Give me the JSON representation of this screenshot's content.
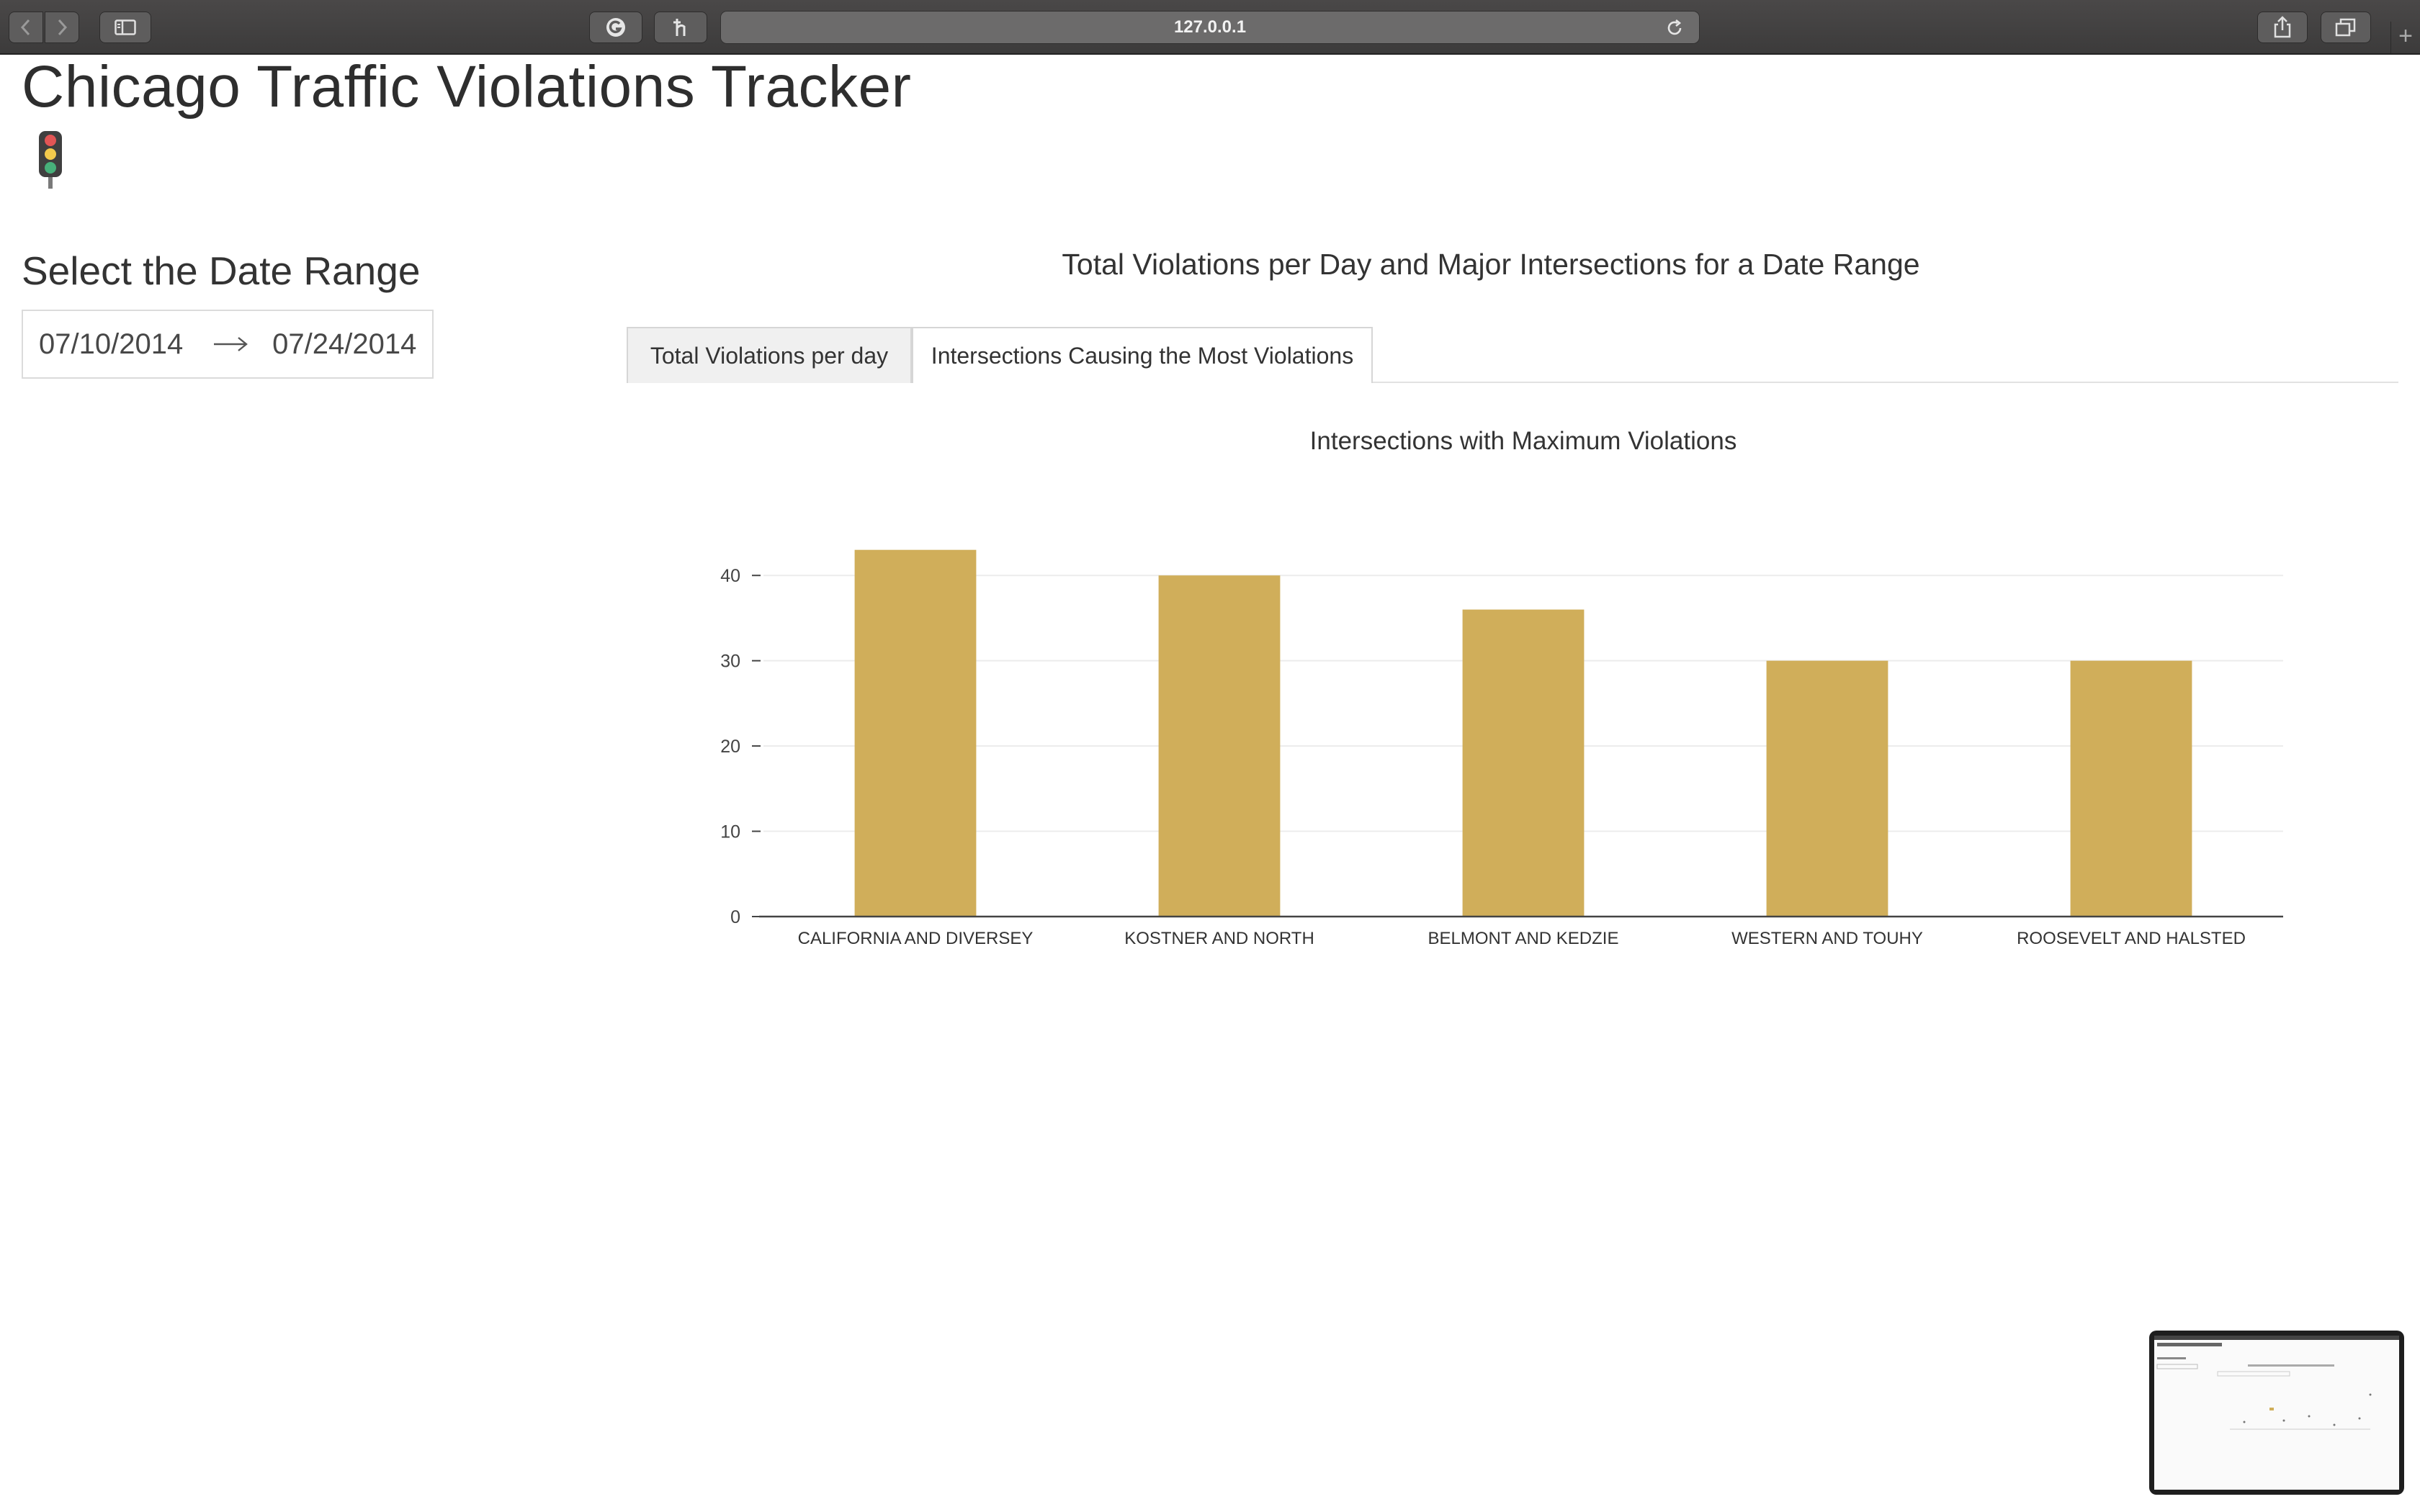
{
  "browser": {
    "url": "127.0.0.1"
  },
  "page": {
    "title": "Chicago Traffic Violations Tracker",
    "icon": "traffic-light-icon"
  },
  "date_picker": {
    "heading": "Select the Date Range",
    "start_date": "07/10/2014",
    "end_date": "07/24/2014"
  },
  "main": {
    "heading": "Total Violations per Day and Major Intersections for a Date Range",
    "tabs": [
      {
        "label": "Total Violations per day",
        "active": true
      },
      {
        "label": "Intersections Causing the Most Violations",
        "active": false
      }
    ]
  },
  "chart_data": {
    "type": "bar",
    "title": "Intersections with Maximum Violations",
    "xlabel": "",
    "ylabel": "",
    "categories": [
      "CALIFORNIA AND DIVERSEY",
      "KOSTNER AND NORTH",
      "BELMONT AND KEDZIE",
      "WESTERN AND TOUHY",
      "ROOSEVELT AND HALSTED"
    ],
    "values": [
      43,
      40,
      36,
      30,
      30
    ],
    "ylim": [
      0,
      45
    ],
    "yticks": [
      0,
      10,
      20,
      30,
      40
    ],
    "grid": true,
    "bar_color": "#d0ae5a"
  }
}
